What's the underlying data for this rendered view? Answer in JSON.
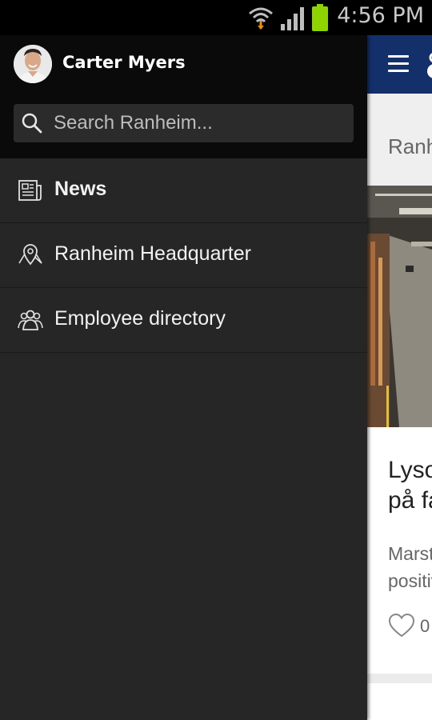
{
  "status_bar": {
    "time": "4:56 PM",
    "icons": [
      "wifi-icon",
      "signal-icon",
      "battery-icon"
    ]
  },
  "drawer": {
    "user": {
      "name": "Carter Myers",
      "avatar": "avatar-photo"
    },
    "search": {
      "placeholder": "Search Ranheim...",
      "value": ""
    },
    "items": [
      {
        "label": "News",
        "icon": "newspaper-icon",
        "active": true
      },
      {
        "label": "Ranheim Headquarter",
        "icon": "map-pin-icon",
        "active": false
      },
      {
        "label": "Employee directory",
        "icon": "people-icon",
        "active": false
      }
    ]
  },
  "background_app": {
    "crumb": "Ranheim",
    "card_title_lines": [
      "Lysoppgradering",
      "på fabrikken"
    ],
    "card_body_lines": [
      "Marstein har satt",
      "positive resultater"
    ],
    "likes": "0"
  },
  "colors": {
    "drawer_bg": "#262626",
    "drawer_header_bg": "#0a0a0a",
    "app_bar": "#13306b",
    "battery": "#8fd400"
  }
}
